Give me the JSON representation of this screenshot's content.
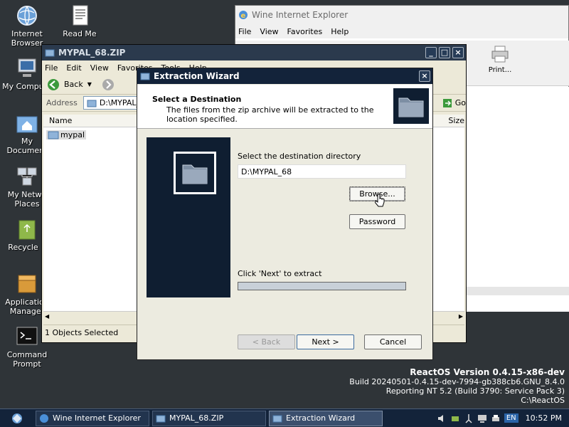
{
  "desktop": {
    "icons": [
      {
        "label": "Internet Browser"
      },
      {
        "label": "Read Me"
      },
      {
        "label": "My Compute"
      },
      {
        "label": "My Document"
      },
      {
        "label": "My Netwo Places"
      },
      {
        "label": "Recycle B"
      },
      {
        "label": "Application Manager"
      },
      {
        "label": "Command Prompt"
      }
    ]
  },
  "wine_ie": {
    "title": "Wine Internet Explorer",
    "menu": [
      "File",
      "View",
      "Favorites",
      "Help"
    ],
    "print_label": "Print..."
  },
  "zip_window": {
    "title": "MYPAL_68.ZIP",
    "menu": [
      "File",
      "Edit",
      "View",
      "Favorites",
      "Tools",
      "Help"
    ],
    "back_label": "Back",
    "address_label": "Address",
    "address_value": "D:\\MYPAL_",
    "go_label": "Go",
    "col_name": "Name",
    "col_size": "Size",
    "file_item": "mypal",
    "status_text": "1 Objects Selected"
  },
  "wizard": {
    "title": "Extraction Wizard",
    "header_title": "Select a Destination",
    "header_subtitle": "The files from the zip archive will be extracted to the location specified.",
    "dest_label": "Select the destination directory",
    "dest_value": "D:\\MYPAL_68",
    "browse_label": "Browse...",
    "password_label": "Password",
    "extract_label": "Click 'Next' to extract",
    "progress": 0,
    "back_label": "< Back",
    "next_label": "Next >",
    "cancel_label": "Cancel"
  },
  "version": {
    "line1": "ReactOS Version 0.4.15-x86-dev",
    "line2": "Build 20240501-0.4.15-dev-7994-gb388cb6.GNU_8.4.0",
    "line3": "Reporting NT 5.2 (Build 3790: Service Pack 3)",
    "line4": "C:\\ReactOS"
  },
  "taskbar": {
    "tasks": [
      {
        "label": "Wine Internet Explorer"
      },
      {
        "label": "MYPAL_68.ZIP"
      },
      {
        "label": "Extraction Wizard"
      }
    ],
    "lang": "EN",
    "clock": "10:52 PM"
  },
  "colors": {
    "titlebar": "#13233a",
    "desktop": "#2f3438",
    "wizard_panel": "#0f1e31"
  }
}
